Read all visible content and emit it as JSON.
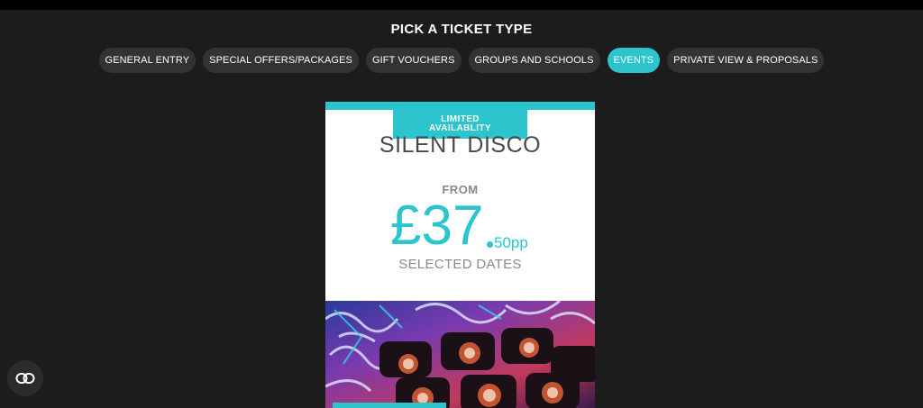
{
  "header": {
    "title": "PICK A TICKET TYPE"
  },
  "tabs": [
    {
      "label": "GENERAL ENTRY",
      "active": false
    },
    {
      "label": "SPECIAL OFFERS/PACKAGES",
      "active": false
    },
    {
      "label": "GIFT VOUCHERS",
      "active": false
    },
    {
      "label": "GROUPS AND SCHOOLS",
      "active": false
    },
    {
      "label": "EVENTS",
      "active": true
    },
    {
      "label": "PRIVATE VIEW & PROPOSALS",
      "active": false
    }
  ],
  "card": {
    "badge_line1": "LIMITED",
    "badge_line2": "AVAILABLITY",
    "name": "SILENT DISCO",
    "from_label": "FROM",
    "price_main": "£37",
    "price_pence": "50pp",
    "dates_label": "SELECTED DATES"
  },
  "colors": {
    "accent": "#2cc5cd",
    "background": "#1c1c1c",
    "tab": "#333333"
  },
  "chat": {
    "icon": "chat-link-icon"
  }
}
